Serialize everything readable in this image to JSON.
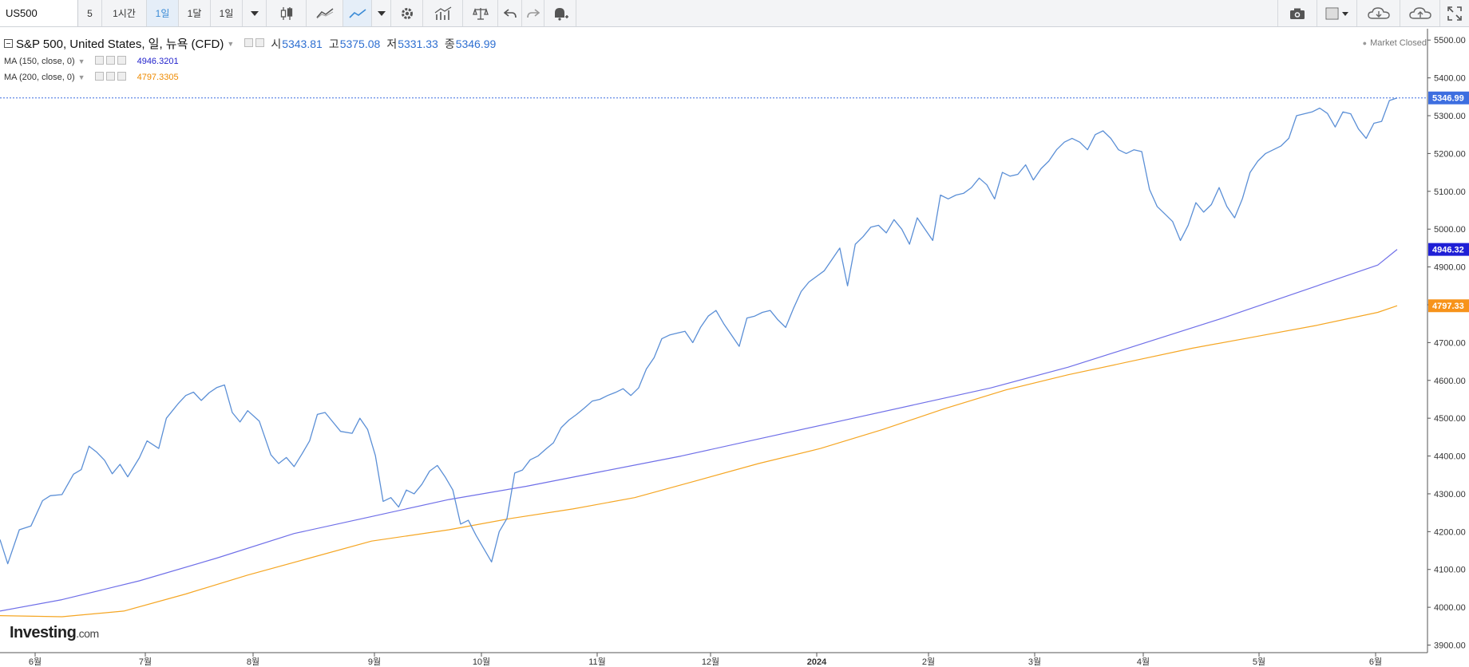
{
  "toolbar": {
    "symbol": "US500",
    "interval_5": "5",
    "interval_1h": "1시간",
    "interval_1d": "1일",
    "interval_1mo": "1달",
    "interval_1w": "1일",
    "icons": [
      "caret-down-icon",
      "candlestick-icon",
      "area-chart-icon",
      "line-chart-icon",
      "caret-down-icon",
      "gear-icon",
      "indicators-icon",
      "compare-icon",
      "undo-icon",
      "redo-icon",
      "alert-icon",
      "camera-icon",
      "template-icon",
      "cloud-download-icon",
      "cloud-upload-icon",
      "fullscreen-icon"
    ]
  },
  "legend": {
    "title": "S&P 500, United States, 일, 뉴욕 (CFD)",
    "open_label": "시",
    "open_value": "5343.81",
    "high_label": "고",
    "high_value": "5375.08",
    "low_label": "저",
    "low_value": "5331.33",
    "close_label": "종",
    "close_value": "5346.99",
    "ma150_label": "MA (150, close, 0)",
    "ma150_value": "4946.3201",
    "ma200_label": "MA (200, close, 0)",
    "ma200_value": "4797.3305",
    "market_status": "Market Closed"
  },
  "logo": {
    "name": "Investing",
    "suffix": ".com"
  },
  "chart_data": {
    "type": "line",
    "title": "S&P 500, United States, 일, 뉴욕 (CFD)",
    "x_tick_labels": [
      "6월",
      "7월",
      "8월",
      "9월",
      "10월",
      "11월",
      "12월",
      "2024",
      "2월",
      "3월",
      "4월",
      "5월",
      "6월"
    ],
    "y_tick_labels": [
      "3900.00",
      "4000.00",
      "4100.00",
      "4200.00",
      "4300.00",
      "4400.00",
      "4500.00",
      "4600.00",
      "4700.00",
      "4800.00",
      "4900.00",
      "5000.00",
      "5100.00",
      "5200.00",
      "5300.00",
      "5400.00",
      "5500.00"
    ],
    "ylim": [
      3880,
      5530
    ],
    "grid": false,
    "price_tags": [
      {
        "label": "5346.99",
        "value": 5346.99,
        "color": "#3d6ee0"
      },
      {
        "label": "4946.32",
        "value": 4946.32,
        "color": "#1f1fd6"
      },
      {
        "label": "4797.33",
        "value": 4797.33,
        "color": "#f7931a"
      }
    ],
    "series": [
      {
        "name": "S&P 500",
        "color": "#5b8fd6",
        "points": [
          [
            2023.42,
            4179
          ],
          [
            2023.43,
            4115
          ],
          [
            2023.445,
            4205
          ],
          [
            2023.46,
            4215
          ],
          [
            2023.475,
            4282
          ],
          [
            2023.485,
            4295
          ],
          [
            2023.5,
            4298
          ],
          [
            2023.515,
            4352
          ],
          [
            2023.525,
            4364
          ],
          [
            2023.535,
            4426
          ],
          [
            2023.545,
            4410
          ],
          [
            2023.555,
            4389
          ],
          [
            2023.565,
            4353
          ],
          [
            2023.575,
            4378
          ],
          [
            2023.585,
            4345
          ],
          [
            2023.6,
            4395
          ],
          [
            2023.61,
            4440
          ],
          [
            2023.625,
            4420
          ],
          [
            2023.635,
            4500
          ],
          [
            2023.65,
            4538
          ],
          [
            2023.66,
            4560
          ],
          [
            2023.67,
            4569
          ],
          [
            2023.68,
            4547
          ],
          [
            2023.69,
            4567
          ],
          [
            2023.7,
            4581
          ],
          [
            2023.71,
            4588
          ],
          [
            2023.72,
            4515
          ],
          [
            2023.73,
            4490
          ],
          [
            2023.74,
            4520
          ],
          [
            2023.755,
            4492
          ],
          [
            2023.77,
            4403
          ],
          [
            2023.78,
            4380
          ],
          [
            2023.79,
            4396
          ],
          [
            2023.8,
            4372
          ],
          [
            2023.81,
            4405
          ],
          [
            2023.82,
            4440
          ],
          [
            2023.83,
            4510
          ],
          [
            2023.84,
            4515
          ],
          [
            2023.85,
            4490
          ],
          [
            2023.86,
            4465
          ],
          [
            2023.875,
            4460
          ],
          [
            2023.885,
            4500
          ],
          [
            2023.895,
            4470
          ],
          [
            2023.905,
            4401
          ],
          [
            2023.915,
            4280
          ],
          [
            2023.925,
            4290
          ],
          [
            2023.935,
            4265
          ],
          [
            2023.945,
            4310
          ],
          [
            2023.955,
            4300
          ],
          [
            2023.965,
            4325
          ],
          [
            2023.975,
            4360
          ],
          [
            2023.985,
            4375
          ],
          [
            2023.995,
            4345
          ],
          [
            2024.005,
            4310
          ],
          [
            2024.015,
            4220
          ],
          [
            2024.025,
            4230
          ],
          [
            2024.035,
            4190
          ],
          [
            2024.045,
            4155
          ],
          [
            2024.055,
            4120
          ],
          [
            2024.065,
            4200
          ],
          [
            2024.075,
            4235
          ],
          [
            2024.085,
            4355
          ],
          [
            2024.095,
            4363
          ],
          [
            2024.105,
            4390
          ],
          [
            2024.115,
            4400
          ],
          [
            2024.125,
            4418
          ],
          [
            2024.135,
            4435
          ],
          [
            2024.145,
            4475
          ],
          [
            2024.155,
            4495
          ],
          [
            2024.165,
            4510
          ],
          [
            2024.175,
            4527
          ],
          [
            2024.185,
            4545
          ],
          [
            2024.195,
            4550
          ],
          [
            2024.205,
            4560
          ],
          [
            2024.215,
            4568
          ],
          [
            2024.225,
            4578
          ],
          [
            2024.235,
            4560
          ],
          [
            2024.245,
            4580
          ],
          [
            2024.255,
            4630
          ],
          [
            2024.265,
            4660
          ],
          [
            2024.275,
            4710
          ],
          [
            2024.285,
            4720
          ],
          [
            2024.295,
            4725
          ],
          [
            2024.305,
            4730
          ],
          [
            2024.315,
            4700
          ],
          [
            2024.325,
            4740
          ],
          [
            2024.335,
            4770
          ],
          [
            2024.345,
            4785
          ],
          [
            2024.355,
            4750
          ],
          [
            2024.365,
            4720
          ],
          [
            2024.375,
            4690
          ],
          [
            2024.385,
            4765
          ],
          [
            2024.395,
            4770
          ],
          [
            2024.405,
            4780
          ],
          [
            2024.415,
            4785
          ],
          [
            2024.425,
            4760
          ],
          [
            2024.435,
            4740
          ],
          [
            2024.445,
            4790
          ],
          [
            2024.455,
            4835
          ],
          [
            2024.465,
            4860
          ],
          [
            2024.475,
            4875
          ],
          [
            2024.485,
            4890
          ],
          [
            2024.495,
            4920
          ],
          [
            2024.505,
            4950
          ],
          [
            2024.515,
            4850
          ],
          [
            2024.525,
            4960
          ],
          [
            2024.535,
            4980
          ],
          [
            2024.545,
            5005
          ],
          [
            2024.555,
            5010
          ],
          [
            2024.565,
            4990
          ],
          [
            2024.575,
            5025
          ],
          [
            2024.585,
            5000
          ],
          [
            2024.595,
            4960
          ],
          [
            2024.605,
            5030
          ],
          [
            2024.615,
            5000
          ],
          [
            2024.625,
            4970
          ],
          [
            2024.635,
            5090
          ],
          [
            2024.645,
            5080
          ],
          [
            2024.655,
            5090
          ],
          [
            2024.665,
            5095
          ],
          [
            2024.675,
            5110
          ],
          [
            2024.685,
            5135
          ],
          [
            2024.695,
            5117
          ],
          [
            2024.705,
            5080
          ],
          [
            2024.715,
            5150
          ],
          [
            2024.725,
            5140
          ],
          [
            2024.735,
            5145
          ],
          [
            2024.745,
            5170
          ],
          [
            2024.755,
            5130
          ],
          [
            2024.765,
            5160
          ],
          [
            2024.775,
            5180
          ],
          [
            2024.785,
            5210
          ],
          [
            2024.795,
            5230
          ],
          [
            2024.805,
            5240
          ],
          [
            2024.815,
            5230
          ],
          [
            2024.825,
            5210
          ],
          [
            2024.835,
            5250
          ],
          [
            2024.845,
            5260
          ],
          [
            2024.855,
            5240
          ],
          [
            2024.865,
            5210
          ],
          [
            2024.875,
            5200
          ],
          [
            2024.885,
            5210
          ],
          [
            2024.895,
            5205
          ],
          [
            2024.905,
            5105
          ],
          [
            2024.915,
            5060
          ],
          [
            2024.925,
            5040
          ],
          [
            2024.935,
            5020
          ],
          [
            2024.945,
            4970
          ],
          [
            2024.955,
            5010
          ],
          [
            2024.965,
            5070
          ],
          [
            2024.975,
            5045
          ],
          [
            2024.985,
            5065
          ],
          [
            2024.995,
            5110
          ],
          [
            2025.005,
            5060
          ],
          [
            2025.015,
            5030
          ],
          [
            2025.025,
            5080
          ],
          [
            2025.035,
            5150
          ],
          [
            2025.045,
            5180
          ],
          [
            2025.055,
            5200
          ],
          [
            2025.065,
            5210
          ],
          [
            2025.075,
            5220
          ],
          [
            2025.085,
            5240
          ],
          [
            2025.095,
            5300
          ],
          [
            2025.105,
            5305
          ],
          [
            2025.115,
            5310
          ],
          [
            2025.125,
            5320
          ],
          [
            2025.135,
            5306
          ],
          [
            2025.145,
            5270
          ],
          [
            2025.155,
            5310
          ],
          [
            2025.165,
            5305
          ],
          [
            2025.175,
            5265
          ],
          [
            2025.185,
            5240
          ],
          [
            2025.195,
            5280
          ],
          [
            2025.205,
            5285
          ],
          [
            2025.215,
            5340
          ],
          [
            2025.225,
            5347
          ]
        ]
      },
      {
        "name": "MA (150, close, 0)",
        "color": "#6f6fe8",
        "points": [
          [
            2023.42,
            3990
          ],
          [
            2023.5,
            4020
          ],
          [
            2023.6,
            4070
          ],
          [
            2023.7,
            4130
          ],
          [
            2023.8,
            4195
          ],
          [
            2023.9,
            4240
          ],
          [
            2024.0,
            4285
          ],
          [
            2024.1,
            4320
          ],
          [
            2024.2,
            4360
          ],
          [
            2024.3,
            4400
          ],
          [
            2024.4,
            4445
          ],
          [
            2024.5,
            4490
          ],
          [
            2024.6,
            4535
          ],
          [
            2024.7,
            4580
          ],
          [
            2024.8,
            4635
          ],
          [
            2024.9,
            4700
          ],
          [
            2025.0,
            4765
          ],
          [
            2025.1,
            4835
          ],
          [
            2025.2,
            4905
          ],
          [
            2025.225,
            4946.32
          ]
        ]
      },
      {
        "name": "MA (200, close, 0)",
        "color": "#f5a623",
        "points": [
          [
            2023.42,
            3978
          ],
          [
            2023.5,
            3975
          ],
          [
            2023.58,
            3990
          ],
          [
            2023.66,
            4035
          ],
          [
            2023.74,
            4085
          ],
          [
            2023.82,
            4130
          ],
          [
            2023.9,
            4175
          ],
          [
            2024.0,
            4205
          ],
          [
            2024.08,
            4235
          ],
          [
            2024.16,
            4260
          ],
          [
            2024.24,
            4290
          ],
          [
            2024.32,
            4335
          ],
          [
            2024.4,
            4380
          ],
          [
            2024.48,
            4420
          ],
          [
            2024.56,
            4470
          ],
          [
            2024.64,
            4525
          ],
          [
            2024.72,
            4575
          ],
          [
            2024.8,
            4615
          ],
          [
            2024.88,
            4650
          ],
          [
            2024.96,
            4685
          ],
          [
            2025.04,
            4715
          ],
          [
            2025.12,
            4745
          ],
          [
            2025.2,
            4780
          ],
          [
            2025.225,
            4797.33
          ]
        ]
      }
    ]
  }
}
